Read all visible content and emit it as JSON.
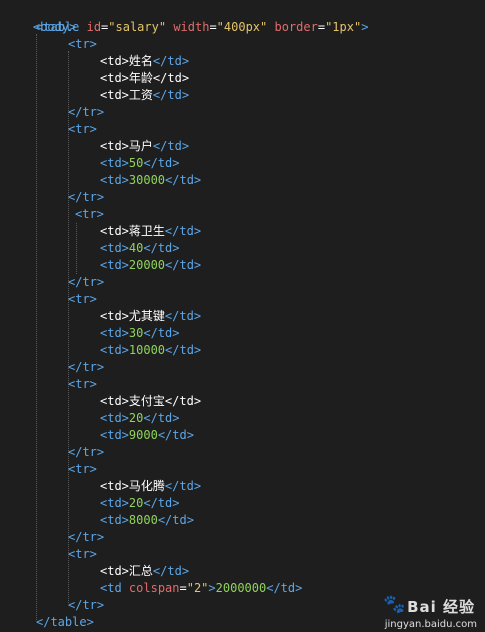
{
  "colors": {
    "background": "#1e1e1e",
    "tag": "#5ca7e8",
    "attribute": "#e06c6c",
    "string": "#e2c46b",
    "text": "#ffffff",
    "number": "#8fd45a"
  },
  "code": {
    "open_body": "<body>",
    "table_open_tag": "<table",
    "table_id_attr": "id",
    "table_id_value": "\"salary\"",
    "table_width_attr": "width",
    "table_width_value": "\"400px\"",
    "table_border_attr": "border",
    "table_border_value": "\"1px\"",
    "table_open_end": ">",
    "tr_open": "<tr>",
    "tr_close": "</tr>",
    "td_open": "<td>",
    "td_close": "</td>",
    "td_open_attr_start": "<td",
    "colspan_attr": "colspan",
    "colspan_value": "\"2\"",
    "gt": ">",
    "eq": "=",
    "close_table": "</table>",
    "header_cells": [
      "姓名",
      "年龄",
      "工资"
    ],
    "rows": [
      [
        "马户",
        "50",
        "30000"
      ],
      [
        "蒋卫生",
        "40",
        "20000"
      ],
      [
        "尤其键",
        "30",
        "10000"
      ],
      [
        "支付宝",
        "20",
        "9000"
      ],
      [
        "马化腾",
        "20",
        "8000"
      ]
    ],
    "summary_label": "汇总",
    "summary_value": "2000000"
  },
  "watermark": {
    "brand": "Bai 经验",
    "site": "jingyan.baidu.com",
    "icon": "baidu-paw-icon"
  }
}
